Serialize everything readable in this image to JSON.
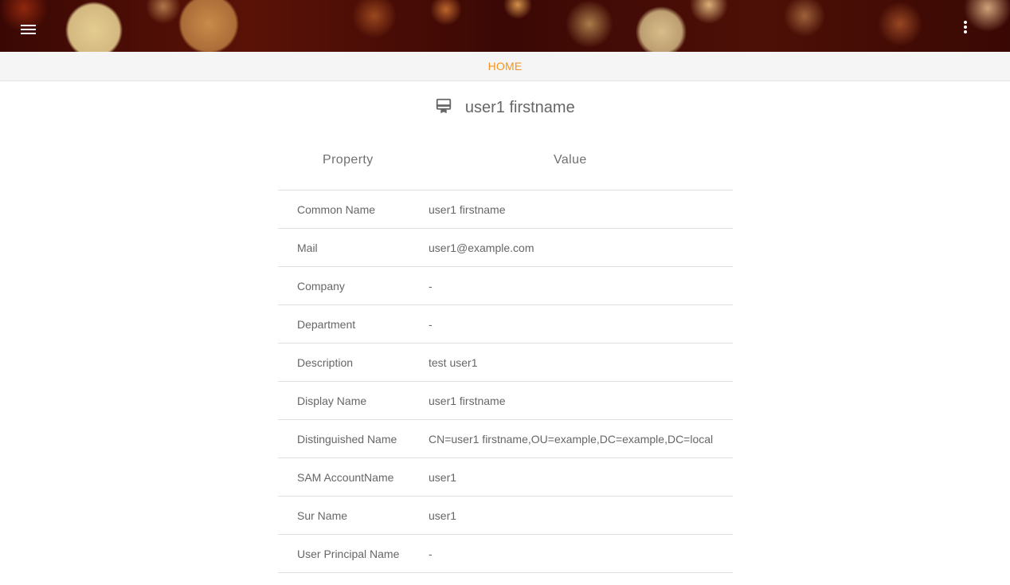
{
  "header": {
    "menu_icon": "hamburger-menu-icon",
    "more_icon": "more-vert-icon"
  },
  "nav": {
    "home_label": "HOME",
    "accent_color": "#f7941d"
  },
  "page": {
    "title_icon": "card-membership-icon",
    "title": "user1 firstname"
  },
  "table": {
    "headers": {
      "property": "Property",
      "value": "Value"
    },
    "rows": [
      {
        "property": "Common Name",
        "value": "user1 firstname"
      },
      {
        "property": "Mail",
        "value": "user1@example.com"
      },
      {
        "property": "Company",
        "value": "-"
      },
      {
        "property": "Department",
        "value": "-"
      },
      {
        "property": "Description",
        "value": "test user1"
      },
      {
        "property": "Display Name",
        "value": "user1 firstname"
      },
      {
        "property": "Distinguished Name",
        "value": "CN=user1 firstname,OU=example,DC=example,DC=local"
      },
      {
        "property": "SAM AccountName",
        "value": "user1"
      },
      {
        "property": "Sur Name",
        "value": "user1"
      },
      {
        "property": "User Principal Name",
        "value": "-"
      }
    ]
  }
}
